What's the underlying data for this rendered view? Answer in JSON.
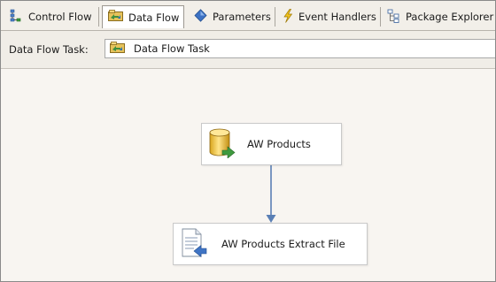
{
  "tabs": [
    {
      "label": "Control Flow",
      "icon": "control-flow-icon"
    },
    {
      "label": "Data Flow",
      "icon": "data-flow-icon",
      "active": true
    },
    {
      "label": "Parameters",
      "icon": "parameters-icon"
    },
    {
      "label": "Event Handlers",
      "icon": "event-handlers-icon"
    },
    {
      "label": "Package Explorer",
      "icon": "package-explorer-icon"
    }
  ],
  "task": {
    "label": "Data Flow Task:",
    "selected": "Data Flow Task"
  },
  "components": [
    {
      "label": "AW Products",
      "icon": "database-source-icon"
    },
    {
      "label": "AW Products Extract File",
      "icon": "flat-file-destination-icon"
    }
  ],
  "colors": {
    "connector": "#5a7fb5",
    "accent_gold": "#e7b53a"
  }
}
